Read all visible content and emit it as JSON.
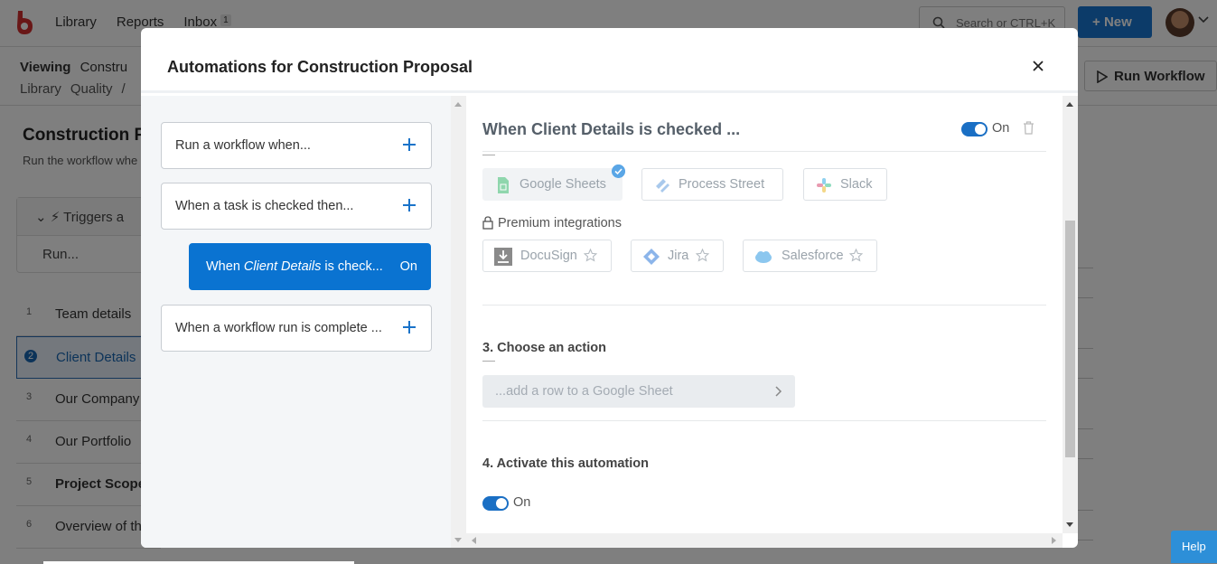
{
  "app": {
    "nav": [
      {
        "label": "Library"
      },
      {
        "label": "Reports"
      },
      {
        "label": "Inbox",
        "badge": "1"
      }
    ],
    "search_placeholder": "Search or CTRL+K",
    "new_button": "New",
    "viewing_label": "Viewing",
    "workflow_short": "Constru",
    "breadcrumbs": [
      "Library",
      "Quality",
      "/"
    ],
    "run_workflow": "Run Workflow",
    "page_title": "Construction P",
    "page_subtitle": "Run the workflow whe",
    "triggers_label": "Triggers a",
    "run_label": "Run...",
    "tasks": [
      {
        "num": "1",
        "label": "Team details"
      },
      {
        "num": "2",
        "label": "Client Details",
        "selected": true
      },
      {
        "num": "3",
        "label": "Our Company"
      },
      {
        "num": "4",
        "label": "Our Portfolio"
      },
      {
        "num": "5",
        "label": "Project Scope"
      },
      {
        "num": "6",
        "label": "Overview of th"
      }
    ],
    "help_label": "Help"
  },
  "modal": {
    "title": "Automations for Construction Proposal",
    "left_items": [
      {
        "label": "Run a workflow when..."
      },
      {
        "label": "When a task is checked then..."
      },
      {
        "label_pre": "When ",
        "label_em": "Client Details",
        "label_post": " is check...",
        "status": "On"
      },
      {
        "label": "When a workflow run is complete ..."
      }
    ],
    "automation_title": "When Client Details is checked ...",
    "automation_status": "On",
    "integrations": [
      {
        "name": "Google Sheets",
        "icon": "google-sheets-icon",
        "selected": true
      },
      {
        "name": "Process Street",
        "icon": "process-street-icon"
      },
      {
        "name": "Slack",
        "icon": "slack-icon"
      }
    ],
    "premium_label": "Premium integrations",
    "premium_integrations": [
      {
        "name": "DocuSign",
        "icon": "docusign-icon"
      },
      {
        "name": "Jira",
        "icon": "jira-icon"
      },
      {
        "name": "Salesforce",
        "icon": "salesforce-icon"
      }
    ],
    "step3_heading": "3. Choose an action",
    "step3_action": "...add a row to a Google Sheet",
    "step4_heading": "4. Activate this automation",
    "step4_status": "On"
  },
  "colors": {
    "accent": "#0a73d1",
    "brand_logo": "#d32f2f"
  }
}
